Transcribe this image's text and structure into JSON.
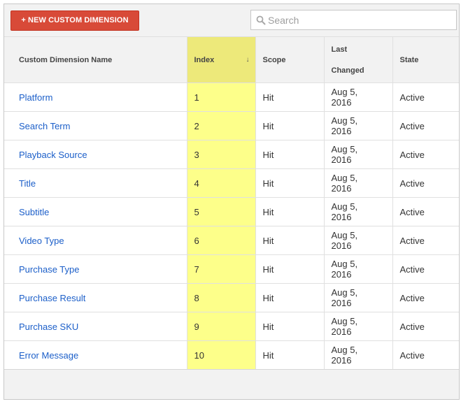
{
  "toolbar": {
    "new_button_label": "+ NEW CUSTOM DIMENSION",
    "search_placeholder": "Search"
  },
  "table": {
    "headers": {
      "name": "Custom Dimension Name",
      "index": "Index",
      "index_sort_icon": "sort-descending-arrow",
      "scope": "Scope",
      "changed_line1": "Last",
      "changed_line2": "Changed",
      "state": "State"
    },
    "rows": [
      {
        "name": "Platform",
        "index": "1",
        "scope": "Hit",
        "changed_1": "Aug 5,",
        "changed_2": "2016",
        "state": "Active"
      },
      {
        "name": "Search Term",
        "index": "2",
        "scope": "Hit",
        "changed_1": "Aug 5,",
        "changed_2": "2016",
        "state": "Active"
      },
      {
        "name": "Playback Source",
        "index": "3",
        "scope": "Hit",
        "changed_1": "Aug 5,",
        "changed_2": "2016",
        "state": "Active"
      },
      {
        "name": "Title",
        "index": "4",
        "scope": "Hit",
        "changed_1": "Aug 5,",
        "changed_2": "2016",
        "state": "Active"
      },
      {
        "name": "Subtitle",
        "index": "5",
        "scope": "Hit",
        "changed_1": "Aug 5,",
        "changed_2": "2016",
        "state": "Active"
      },
      {
        "name": "Video Type",
        "index": "6",
        "scope": "Hit",
        "changed_1": "Aug 5,",
        "changed_2": "2016",
        "state": "Active"
      },
      {
        "name": "Purchase Type",
        "index": "7",
        "scope": "Hit",
        "changed_1": "Aug 5,",
        "changed_2": "2016",
        "state": "Active"
      },
      {
        "name": "Purchase Result",
        "index": "8",
        "scope": "Hit",
        "changed_1": "Aug 5,",
        "changed_2": "2016",
        "state": "Active"
      },
      {
        "name": "Purchase SKU",
        "index": "9",
        "scope": "Hit",
        "changed_1": "Aug 5,",
        "changed_2": "2016",
        "state": "Active"
      },
      {
        "name": "Error Message",
        "index": "10",
        "scope": "Hit",
        "changed_1": "Aug 5,",
        "changed_2": "2016",
        "state": "Active"
      }
    ]
  },
  "colors": {
    "accent_button": "#d84a38",
    "link": "#1c5fc9",
    "index_highlight": "#fdff8a",
    "index_header_highlight": "#ede97a"
  }
}
